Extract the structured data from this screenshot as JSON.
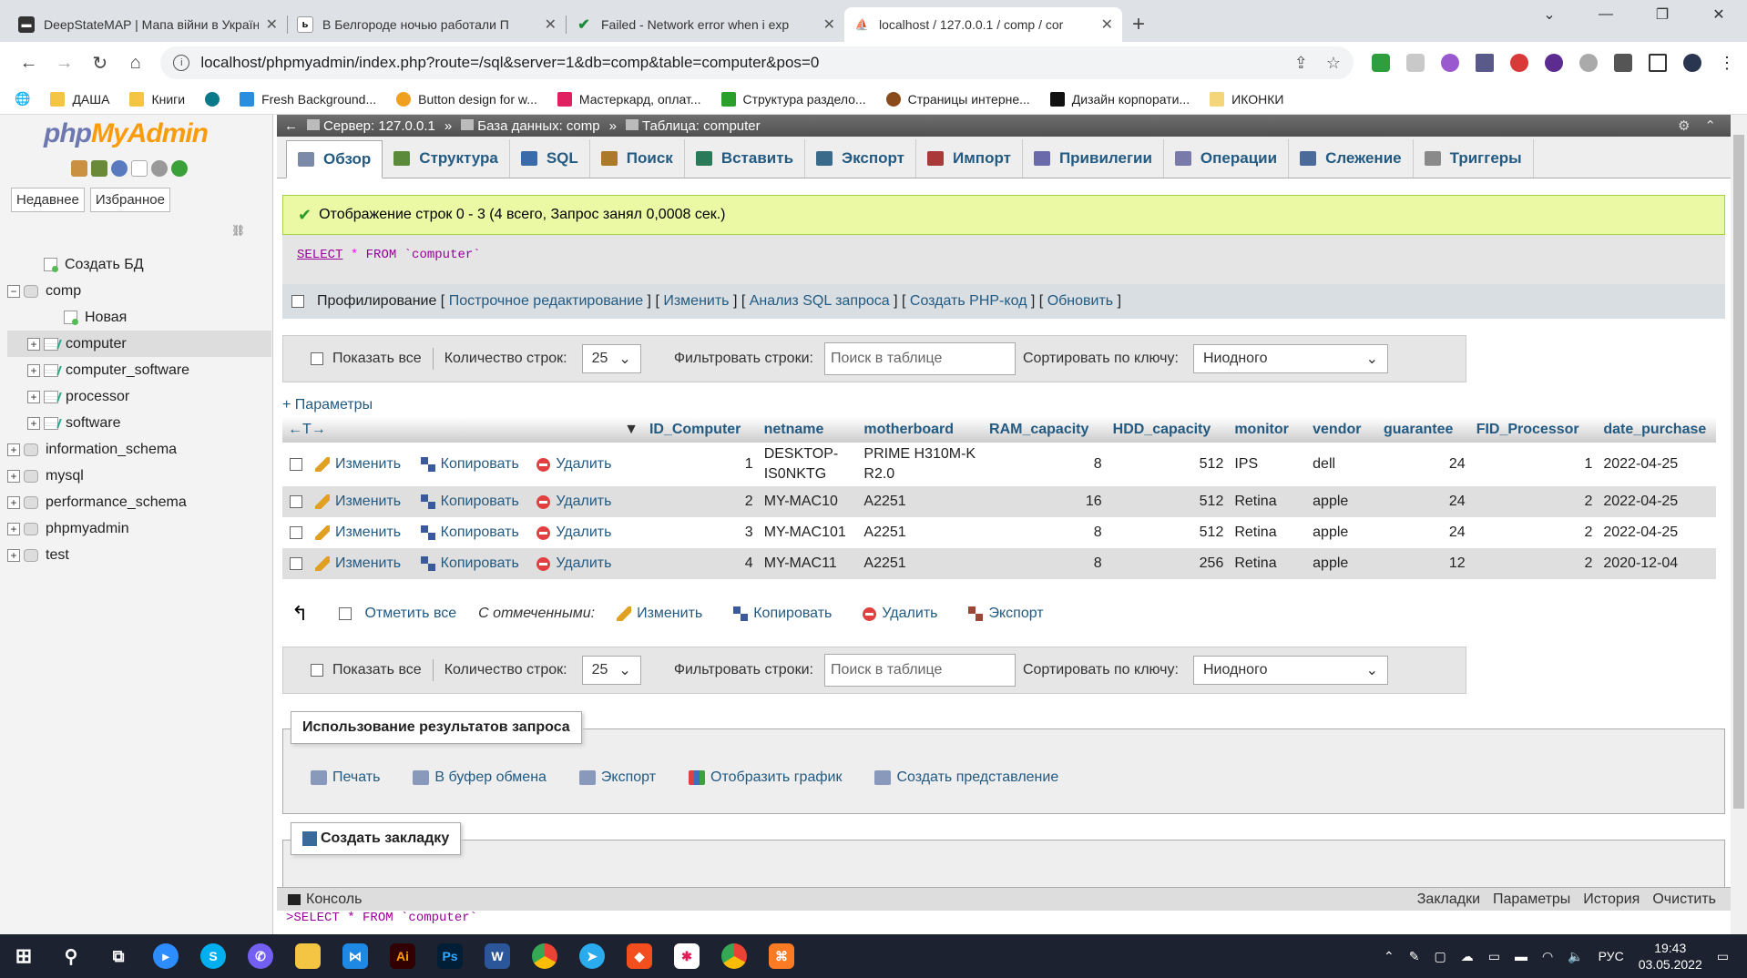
{
  "browser": {
    "tabs": [
      {
        "title": "DeepStateMAP | Мапа війни в Україні",
        "active": false
      },
      {
        "title": "В Белгороде ночью работали П",
        "active": false
      },
      {
        "title": "Failed - Network error when i exp",
        "active": false
      },
      {
        "title": "localhost / 127.0.0.1 / comp / cor",
        "active": true
      }
    ],
    "url": "localhost/phpmyadmin/index.php?route=/sql&server=1&db=comp&table=computer&pos=0",
    "bookmarks": [
      "ДАША",
      "Книги",
      "Fresh Background...",
      "Button design for w...",
      "Мастеркард, оплат...",
      "Структура раздело...",
      "Страницы интерне...",
      "Дизайн корпорати...",
      "ИКОНКИ"
    ]
  },
  "pma": {
    "logo_php": "php",
    "logo_myadmin": "MyAdmin",
    "left_tabs": [
      "Недавнее",
      "Избранное"
    ],
    "tree": [
      {
        "label": "Создать БД",
        "level": 1,
        "kind": "new"
      },
      {
        "label": "comp",
        "level": 0,
        "kind": "db",
        "expanded": true
      },
      {
        "label": "Новая",
        "level": 2,
        "kind": "new"
      },
      {
        "label": "computer",
        "level": 1,
        "kind": "table",
        "selected": true
      },
      {
        "label": "computer_software",
        "level": 1,
        "kind": "table"
      },
      {
        "label": "processor",
        "level": 1,
        "kind": "table"
      },
      {
        "label": "software",
        "level": 1,
        "kind": "table"
      },
      {
        "label": "information_schema",
        "level": 0,
        "kind": "db"
      },
      {
        "label": "mysql",
        "level": 0,
        "kind": "db"
      },
      {
        "label": "performance_schema",
        "level": 0,
        "kind": "db"
      },
      {
        "label": "phpmyadmin",
        "level": 0,
        "kind": "db"
      },
      {
        "label": "test",
        "level": 0,
        "kind": "db"
      }
    ],
    "breadcrumb": {
      "server": "Сервер: 127.0.0.1",
      "database": "База данных: comp",
      "table": "Таблица: computer"
    },
    "menu": [
      "Обзор",
      "Структура",
      "SQL",
      "Поиск",
      "Вставить",
      "Экспорт",
      "Импорт",
      "Привилегии",
      "Операции",
      "Слежение",
      "Триггеры"
    ],
    "success_msg": "Отображение строк 0 - 3 (4 всего, Запрос занял 0,0008 сек.)",
    "sql": {
      "select": "SELECT",
      "star": "*",
      "from": "FROM",
      "table": "`computer`"
    },
    "profiling": {
      "label": "Профилирование",
      "links": [
        "Построчное редактирование",
        "Изменить",
        "Анализ SQL запроса",
        "Создать PHP-код",
        "Обновить"
      ]
    },
    "nav": {
      "show_all": "Показать все",
      "rows_label": "Количество строк:",
      "rows_value": "25",
      "filter_label": "Фильтровать строки:",
      "filter_placeholder": "Поиск в таблице",
      "sort_label": "Сортировать по ключу:",
      "sort_value": "Ниодного"
    },
    "params_link": "+ Параметры",
    "columns": [
      "ID_Computer",
      "netname",
      "motherboard",
      "RAM_capacity",
      "HDD_capacity",
      "monitor",
      "vendor",
      "guarantee",
      "FID_Processor",
      "date_purchase"
    ],
    "row_actions": {
      "edit": "Изменить",
      "copy": "Копировать",
      "delete": "Удалить"
    },
    "rows": [
      {
        "ID_Computer": "1",
        "netname": "DESKTOP-IS0NKTG",
        "motherboard": "PRIME H310M-K R2.0",
        "RAM_capacity": "8",
        "HDD_capacity": "512",
        "monitor": "IPS",
        "vendor": "dell",
        "guarantee": "24",
        "FID_Processor": "1",
        "date_purchase": "2022-04-25"
      },
      {
        "ID_Computer": "2",
        "netname": "MY-MAC10",
        "motherboard": "A2251",
        "RAM_capacity": "16",
        "HDD_capacity": "512",
        "monitor": "Retina",
        "vendor": "apple",
        "guarantee": "24",
        "FID_Processor": "2",
        "date_purchase": "2022-04-25"
      },
      {
        "ID_Computer": "3",
        "netname": "MY-MAC101",
        "motherboard": "A2251",
        "RAM_capacity": "8",
        "HDD_capacity": "512",
        "monitor": "Retina",
        "vendor": "apple",
        "guarantee": "24",
        "FID_Processor": "2",
        "date_purchase": "2022-04-25"
      },
      {
        "ID_Computer": "4",
        "netname": "MY-MAC11",
        "motherboard": "A2251",
        "RAM_capacity": "8",
        "HDD_capacity": "256",
        "monitor": "Retina",
        "vendor": "apple",
        "guarantee": "12",
        "FID_Processor": "2",
        "date_purchase": "2020-12-04"
      }
    ],
    "with_selected": {
      "check_all": "Отметить все",
      "label": "С отмеченными:",
      "edit": "Изменить",
      "copy": "Копировать",
      "delete": "Удалить",
      "export": "Экспорт"
    },
    "query_results": {
      "legend": "Использование результатов запроса",
      "links": [
        "Печать",
        "В буфер обмена",
        "Экспорт",
        "Отобразить график",
        "Создать представление"
      ]
    },
    "bookmark_legend": "Создать закладку",
    "console": {
      "label": "Консоль",
      "links": [
        "Закладки",
        "Параметры",
        "История",
        "Очистить"
      ],
      "line": ">SELECT * FROM `computer`"
    }
  },
  "taskbar": {
    "lang": "РУС",
    "time": "19:43",
    "date": "03.05.2022"
  }
}
